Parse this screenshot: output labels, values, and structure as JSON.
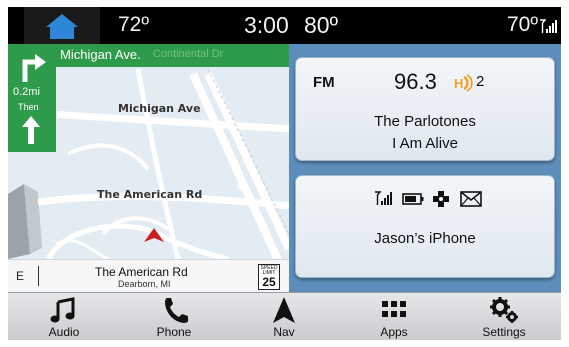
{
  "status_bar": {
    "home_icon": "home-icon",
    "temp_left": "72º",
    "time": "3:00",
    "temp_mid": "80º",
    "temp_right": "70º",
    "signal_icon": "signal-bars-icon"
  },
  "map": {
    "next_street": "Michigan Ave.",
    "cross_street": "Continental Dr",
    "turn_icon": "turn-right-arrow-icon",
    "turn_distance": "0.2mi",
    "then_label": "Then",
    "then_icon": "straight-arrow-icon",
    "street_labels": [
      "Michigan Ave",
      "The American Rd"
    ],
    "compass": "E",
    "current_street": "The American Rd",
    "current_city": "Dearborn, MI",
    "speed_caption": "SPEED LIMIT",
    "speed_limit": "25",
    "vehicle_icon": "vehicle-position-arrow-icon"
  },
  "radio": {
    "band": "FM",
    "frequency": "96.3",
    "hd_icon": "hd-radio-icon",
    "hd_channel": "2",
    "artist": "The Parlotones",
    "song": "I Am Alive"
  },
  "phone": {
    "icons": [
      "signal-bars-icon",
      "battery-icon",
      "roaming-icon",
      "message-envelope-icon"
    ],
    "device_name": "Jason’s iPhone"
  },
  "bottom_nav": [
    {
      "label": "Audio",
      "icon": "music-note-icon"
    },
    {
      "label": "Phone",
      "icon": "phone-handset-icon"
    },
    {
      "label": "Nav",
      "icon": "nav-arrow-icon"
    },
    {
      "label": "Apps",
      "icon": "apps-grid-icon"
    },
    {
      "label": "Settings",
      "icon": "gears-icon"
    }
  ],
  "colors": {
    "nav_banner": "#2e9b4a",
    "media_background": "#5d8ebb",
    "home_icon": "#2e86d6",
    "vehicle_marker": "#cc1f1f",
    "hd_icon": "#f2a01f"
  }
}
